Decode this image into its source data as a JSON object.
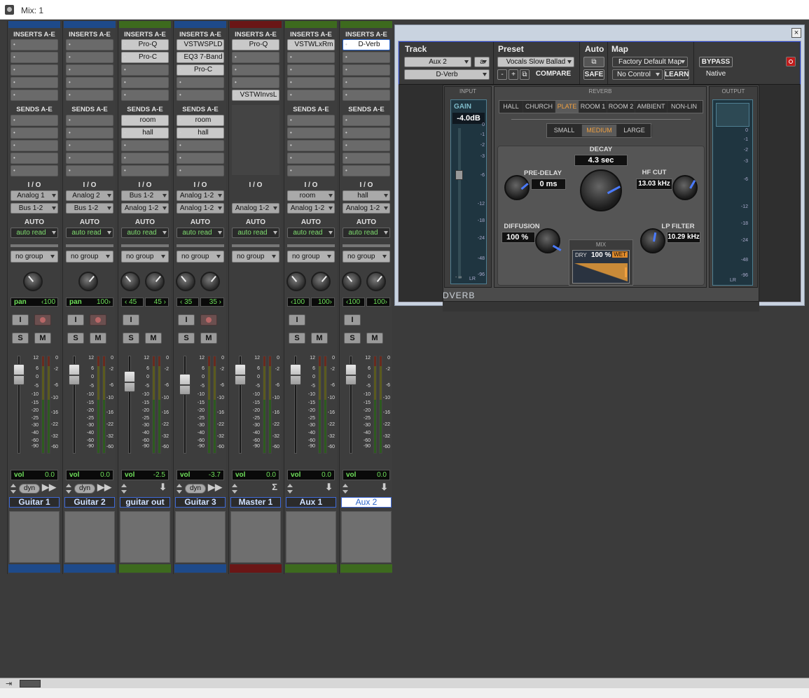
{
  "window": {
    "title": "Mix: 1"
  },
  "labels": {
    "inserts": "INSERTS A-E",
    "sends": "SENDS A-E",
    "io": "I / O",
    "auto": "AUTO",
    "solo": "S",
    "mute": "M",
    "input": "I",
    "vol": "vol",
    "dyn": "dyn"
  },
  "strips": [
    {
      "name": "Guitar 1",
      "color": "#1e4a8a",
      "inserts": [
        "",
        "",
        "",
        "",
        ""
      ],
      "sends": [
        "",
        "",
        "",
        "",
        ""
      ],
      "input": "Analog 1",
      "output": "Bus 1-2",
      "auto": "auto read",
      "group": "no group",
      "pan": {
        "mode": "single",
        "label": "pan",
        "value": "‹100"
      },
      "vol": "0.0",
      "dyn": true,
      "rec": true,
      "footIcon": "▶▶"
    },
    {
      "name": "Guitar 2",
      "color": "#1e4a8a",
      "inserts": [
        "",
        "",
        "",
        "",
        ""
      ],
      "sends": [
        "",
        "",
        "",
        "",
        ""
      ],
      "input": "Analog 2",
      "output": "Bus 1-2",
      "auto": "auto read",
      "group": "no group",
      "pan": {
        "mode": "single",
        "label": "pan",
        "value": "100›"
      },
      "vol": "0.0",
      "dyn": true,
      "rec": true,
      "footIcon": "▶▶"
    },
    {
      "name": "guitar out",
      "color": "#3d6a1e",
      "inserts": [
        "Pro-Q",
        "Pro-C",
        "",
        "",
        ""
      ],
      "sends": [
        "room",
        "hall",
        "",
        "",
        ""
      ],
      "input": "Bus 1-2",
      "output": "Analog 1-2",
      "auto": "auto read",
      "group": "no group",
      "pan": {
        "mode": "stereo",
        "left": "‹ 45",
        "right": "45 ›"
      },
      "vol": "-2.5",
      "dyn": false,
      "rec": false,
      "footIcon": "⬇"
    },
    {
      "name": "Guitar 3",
      "color": "#1e4a8a",
      "inserts": [
        "VSTWSPLD",
        "EQ3 7-Band",
        "Pro-C",
        "",
        ""
      ],
      "sends": [
        "room",
        "hall",
        "",
        "",
        ""
      ],
      "input": "Analog 1-2",
      "output": "Analog 1-2",
      "auto": "auto read",
      "group": "no group",
      "pan": {
        "mode": "stereo",
        "left": "‹ 35",
        "right": "35 ›"
      },
      "vol": "-3.7",
      "dyn": true,
      "rec": true,
      "footIcon": "▶▶"
    },
    {
      "name": "Master 1",
      "color": "#6a1616",
      "inserts": [
        "Pro-Q",
        "",
        "",
        "",
        "VSTWInvsL"
      ],
      "sends": [],
      "input": "",
      "output": "Analog 1-2",
      "auto": "auto read",
      "group": "no group",
      "pan": null,
      "vol": "0.0",
      "dyn": false,
      "rec": false,
      "footIcon": "Σ"
    },
    {
      "name": "Aux 1",
      "color": "#3d6a1e",
      "inserts": [
        "VSTWLxRm",
        "",
        "",
        "",
        ""
      ],
      "sends": [
        "",
        "",
        "",
        "",
        ""
      ],
      "input": "room",
      "output": "Analog 1-2",
      "auto": "auto read",
      "group": "no group",
      "pan": {
        "mode": "stereo",
        "left": "‹100",
        "right": "100›"
      },
      "vol": "0.0",
      "dyn": false,
      "rec": false,
      "footIcon": "⬇"
    },
    {
      "name": "Aux 2",
      "color": "#3d6a1e",
      "inserts": [
        "D-Verb",
        "",
        "",
        "",
        ""
      ],
      "sends": [
        "",
        "",
        "",
        "",
        ""
      ],
      "input": "hall",
      "output": "Analog 1-2",
      "auto": "auto read",
      "group": "no group",
      "pan": {
        "mode": "stereo",
        "left": "‹100",
        "right": "100›"
      },
      "vol": "0.0",
      "dyn": false,
      "rec": false,
      "footIcon": "⬇",
      "selected": true
    }
  ],
  "plugin": {
    "track_title": "Track",
    "preset_title": "Preset",
    "auto_title": "Auto",
    "map_title": "Map",
    "track": "Aux 2",
    "track_letter": "a",
    "insert": "D-Verb",
    "preset": "Vocals Slow Ballad",
    "compare": "COMPARE",
    "safe": "SAFE",
    "map": "Factory Default Map",
    "control": "No Control",
    "learn": "LEARN",
    "bypass": "BYPASS",
    "native": "Native",
    "input_label": "INPUT",
    "reverb_label": "REVERB",
    "output_label": "OUTPUT",
    "gain_label": "GAIN",
    "gain_value": "-4.0dB",
    "algorithms": [
      "HALL",
      "CHURCH",
      "PLATE",
      "ROOM 1",
      "ROOM 2",
      "AMBIENT",
      "NON-LIN"
    ],
    "active_algorithm": "PLATE",
    "sizes": [
      "SMALL",
      "MEDIUM",
      "LARGE"
    ],
    "active_size": "MEDIUM",
    "decay_label": "DECAY",
    "decay_value": "4.3 sec",
    "predelay_label": "PRE-DELAY",
    "predelay_value": "0 ms",
    "hfcut_label": "HF CUT",
    "hfcut_value": "13.03 kHz",
    "diffusion_label": "DIFFUSION",
    "diffusion_value": "100 %",
    "lpfilter_label": "LP FILTER",
    "lpfilter_value": "10.29 kHz",
    "mix_label": "MIX",
    "mix_dry": "DRY",
    "mix_value": "100 %",
    "mix_wet": "WET",
    "plugin_name": "DVERB",
    "meter_scale": [
      "0",
      "-1",
      "-2",
      "-3",
      "-6",
      "-12",
      "-18",
      "-24",
      "-48",
      "-96"
    ],
    "meter_lr": "LR",
    "input_scale_bottom": "- ∞"
  },
  "fader_scale": [
    "12",
    "6",
    "0",
    "-5",
    "-10",
    "-15",
    "-20",
    "-25",
    "-30",
    "-40",
    "-60",
    "-90"
  ],
  "meter_scale": [
    "0",
    "-2",
    "-6",
    "-10",
    "-16",
    "-22",
    "-32",
    "-60"
  ]
}
